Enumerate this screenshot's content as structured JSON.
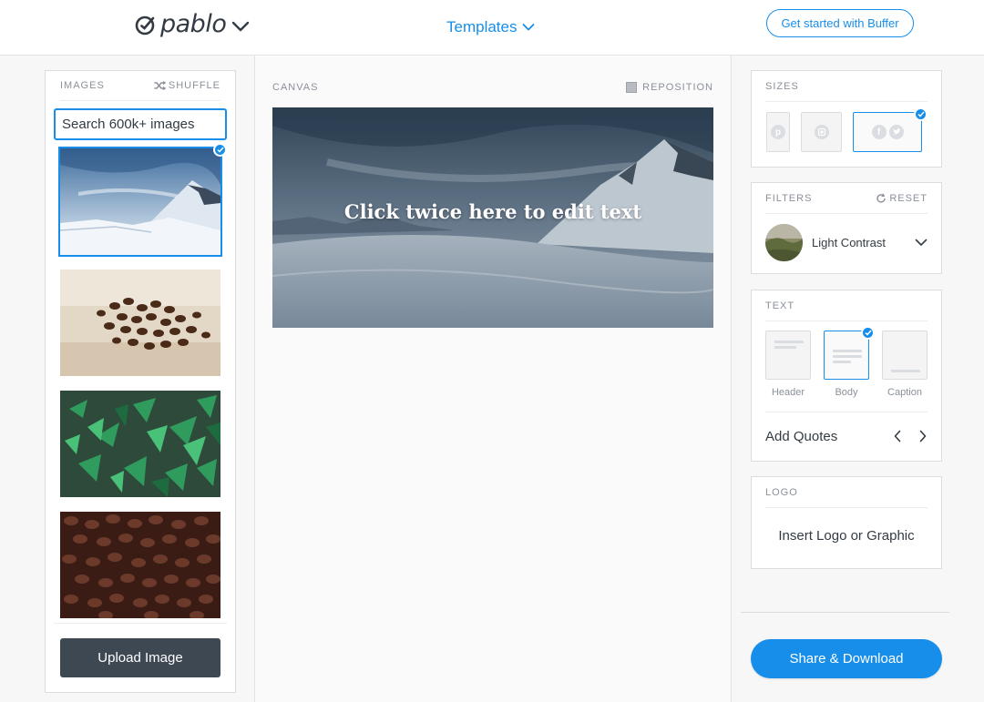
{
  "header": {
    "logo_text": "pablo",
    "templates_label": "Templates",
    "cta_label": "Get started with Buffer"
  },
  "images_panel": {
    "title": "IMAGES",
    "shuffle_label": "SHUFFLE",
    "search_placeholder": "Search 600k+ images",
    "thumbnails": [
      {
        "name": "snowy-mountains",
        "selected": true
      },
      {
        "name": "coffee-beans-on-wood",
        "selected": false
      },
      {
        "name": "green-plants",
        "selected": false
      },
      {
        "name": "coffee-beans-closeup",
        "selected": false
      }
    ],
    "upload_label": "Upload Image"
  },
  "canvas": {
    "title": "CANVAS",
    "reposition_label": "REPOSITION",
    "overlay_text": "Click twice here to edit text"
  },
  "sizes": {
    "title": "SIZES",
    "options": [
      {
        "name": "pinterest",
        "selected": false
      },
      {
        "name": "instagram",
        "selected": false
      },
      {
        "name": "facebook-twitter",
        "selected": true
      }
    ]
  },
  "filters": {
    "title": "FILTERS",
    "reset_label": "RESET",
    "selected_filter": "Light Contrast"
  },
  "text": {
    "title": "TEXT",
    "options": [
      {
        "label": "Header",
        "selected": false
      },
      {
        "label": "Body",
        "selected": true
      },
      {
        "label": "Caption",
        "selected": false
      }
    ],
    "quotes_label": "Add Quotes"
  },
  "logo": {
    "title": "LOGO",
    "action_label": "Insert Logo or Graphic"
  },
  "share": {
    "label": "Share & Download"
  },
  "colors": {
    "accent": "#168eea",
    "dark_button": "#3d4853",
    "text_dark": "#323b43",
    "text_muted": "#8b9099"
  }
}
